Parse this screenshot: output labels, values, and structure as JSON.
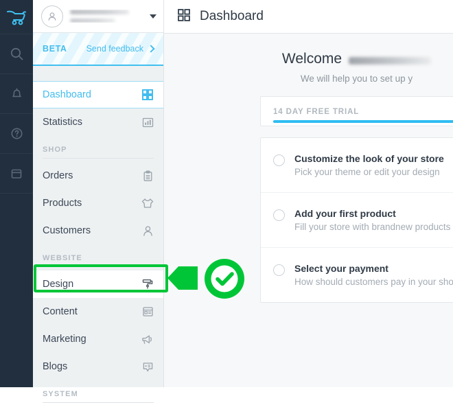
{
  "colors": {
    "rail_bg": "#222f3e",
    "sidebar_bg": "#eef1f2",
    "accent_blue": "#43bdee",
    "progress_blue": "#2fbdf2",
    "highlight_green": "#00c637",
    "text_dark": "#2f3a46",
    "text_muted": "#a3abb3"
  },
  "rail": {
    "items": [
      {
        "icon": "shopping-cart-logo-icon",
        "active": true
      },
      {
        "icon": "search-icon",
        "active": false
      },
      {
        "icon": "bell-icon",
        "active": false
      },
      {
        "icon": "help-circle-icon",
        "active": false
      },
      {
        "icon": "archive-box-icon",
        "active": false
      }
    ]
  },
  "sidebar": {
    "user": {
      "avatar_icon": "user-avatar-icon",
      "name": "",
      "email": "",
      "redacted": true,
      "dropdown_icon": "chevron-down-icon"
    },
    "beta": {
      "label": "BETA",
      "feedback_label": "Send feedback",
      "feedback_icon": "chevron-right-icon"
    },
    "nav": [
      {
        "label": "Dashboard",
        "icon": "grid-dashboard-icon",
        "state": "active"
      },
      {
        "label": "Statistics",
        "icon": "bar-chart-icon",
        "state": "normal"
      }
    ],
    "sections": [
      {
        "title": "SHOP",
        "items": [
          {
            "label": "Orders",
            "icon": "clipboard-icon",
            "state": "normal"
          },
          {
            "label": "Products",
            "icon": "tshirt-icon",
            "state": "normal"
          },
          {
            "label": "Customers",
            "icon": "person-icon",
            "state": "normal"
          }
        ]
      },
      {
        "title": "WEBSITE",
        "items": [
          {
            "label": "Design",
            "icon": "paint-roller-icon",
            "state": "highlighted"
          },
          {
            "label": "Content",
            "icon": "page-layout-icon",
            "state": "normal"
          },
          {
            "label": "Marketing",
            "icon": "megaphone-icon",
            "state": "normal"
          },
          {
            "label": "Blogs",
            "icon": "comment-bubble-icon",
            "state": "normal"
          }
        ]
      },
      {
        "title": "SYSTEM",
        "items": []
      }
    ],
    "annotation": {
      "type": "green-highlight-with-check",
      "target": "Design",
      "check_icon": "check-circle-icon"
    }
  },
  "topbar": {
    "icon": "grid-dashboard-icon",
    "title": "Dashboard"
  },
  "main": {
    "welcome": {
      "greeting": "Welcome",
      "name_redacted": true,
      "subtitle": "We will help you to set up y"
    },
    "trial": {
      "label": "14 DAY FREE TRIAL",
      "progress_percent": 100
    },
    "tasks": [
      {
        "title": "Customize the look of your store",
        "subtitle": "Pick your theme or edit your design",
        "completed": false
      },
      {
        "title": "Add your first product",
        "subtitle": "Fill your store with brandnew products",
        "completed": false
      },
      {
        "title": "Select your payment",
        "subtitle": "How should customers pay in your shop?",
        "completed": false
      }
    ]
  }
}
